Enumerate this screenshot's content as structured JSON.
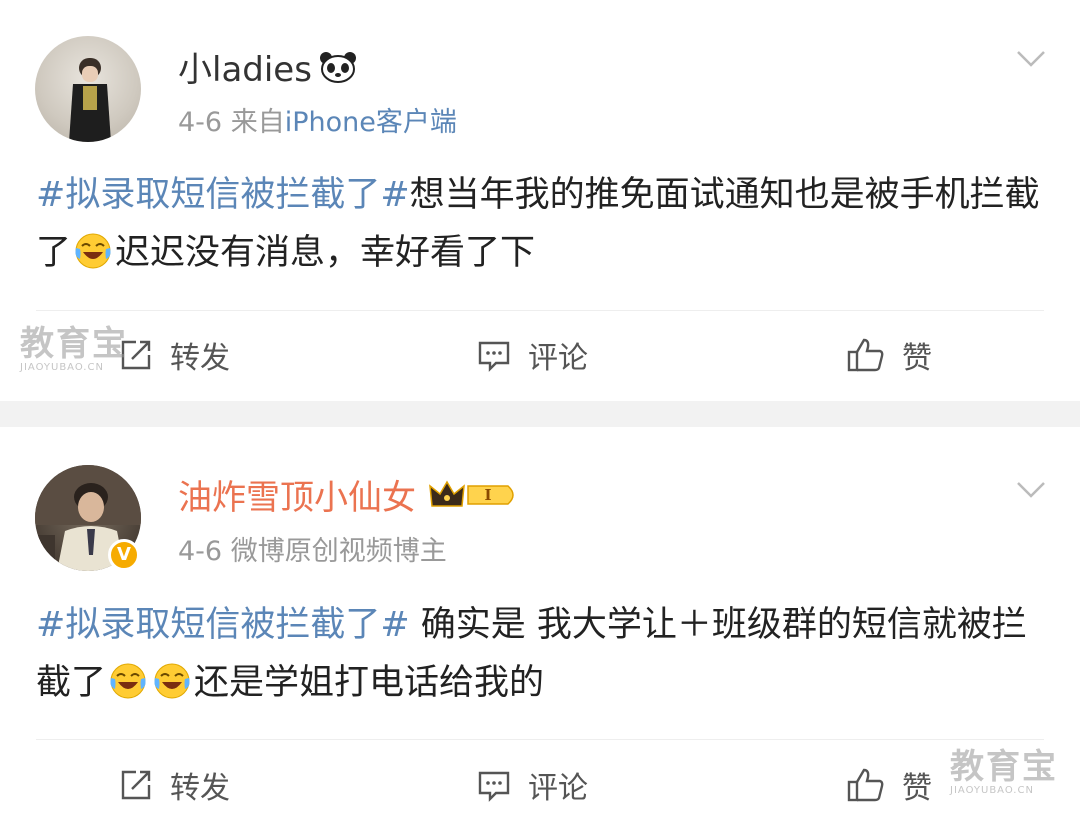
{
  "posts": [
    {
      "username": "小ladies",
      "date": "4-6",
      "source_prefix": "来自",
      "source": "iPhone客户端",
      "hashtag": "#拟录取短信被拦截了#",
      "text_part1": "想当年我的推免面试通知也是被手机拦截了",
      "text_part2": "迟迟没有消息，幸好看了下",
      "emoji": "laugh-cry",
      "actions": {
        "repost": "转发",
        "comment": "评论",
        "like": "赞"
      }
    },
    {
      "username": "油炸雪顶小仙女",
      "badge_level": "I",
      "verified": "V",
      "date": "4-6",
      "source": "微博原创视频博主",
      "hashtag": "#拟录取短信被拦截了#",
      "text_part1": " 确实是 我大学让＋班级群的短信就被拦截了",
      "text_part2": "还是学姐打电话给我的",
      "emoji": "laugh-cry",
      "actions": {
        "repost": "转发",
        "comment": "评论",
        "like": "赞"
      }
    }
  ],
  "watermark": {
    "main": "教育宝",
    "sub": "JIAOYUBAO.CN"
  },
  "colors": {
    "link": "#5b86b7",
    "vip_name": "#eb7350",
    "muted": "#999999",
    "separator": "#f2f2f2"
  }
}
